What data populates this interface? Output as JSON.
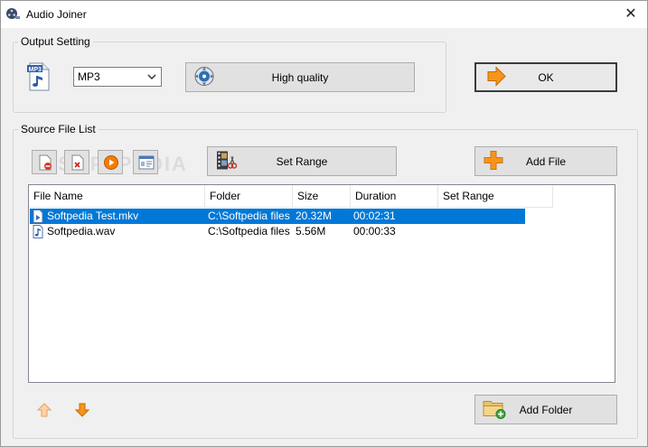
{
  "window": {
    "title": "Audio Joiner",
    "close_glyph": "✕"
  },
  "output_setting": {
    "legend": "Output Setting",
    "format_value": "MP3",
    "quality_label": "High quality",
    "ok_label": "OK"
  },
  "source_list": {
    "legend": "Source File List",
    "set_range_label": "Set Range",
    "add_file_label": "Add File",
    "add_folder_label": "Add Folder",
    "columns": [
      "File Name",
      "Folder",
      "Size",
      "Duration",
      "Set Range"
    ],
    "rows": [
      {
        "name": "Softpedia Test.mkv",
        "folder": "C:\\Softpedia files",
        "size": "20.32M",
        "duration": "00:02:31",
        "range": ""
      },
      {
        "name": "Softpedia.wav",
        "folder": "C:\\Softpedia files",
        "size": "5.56M",
        "duration": "00:00:33",
        "range": ""
      }
    ],
    "selected_row": 0
  },
  "watermark": "SOFTPEDIA",
  "colors": {
    "selection": "#0078d7",
    "accent_orange": "#f7941d"
  },
  "icons": [
    "film-reel-icon",
    "close-icon",
    "mp3-file-icon",
    "quality-disc-icon",
    "ok-arrow-icon",
    "remove-file-icon",
    "delete-icon",
    "play-icon",
    "properties-icon",
    "film-scissors-icon",
    "add-plus-icon",
    "move-up-icon",
    "move-down-icon",
    "add-folder-icon"
  ]
}
